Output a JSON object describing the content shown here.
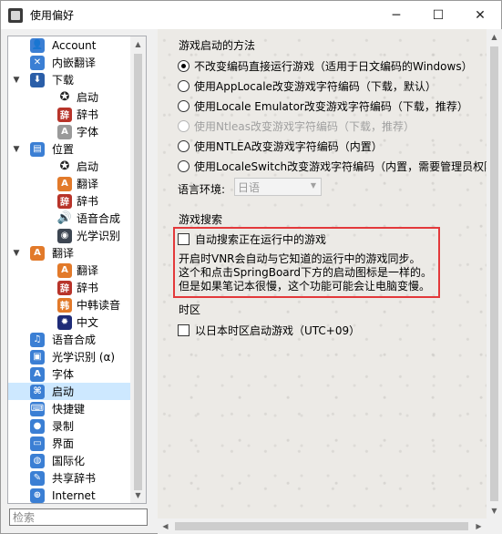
{
  "window": {
    "title": "使用偏好",
    "minimize": "─",
    "maximize": "☐",
    "close": "✕"
  },
  "tree": {
    "items": [
      {
        "label": "Account",
        "icon": "account-icon"
      },
      {
        "label": "内嵌翻译",
        "icon": "wrench-icon"
      },
      {
        "label": "下载",
        "icon": "download-icon",
        "expander": "▼"
      },
      {
        "label": "启动",
        "icon": "launch-icon"
      },
      {
        "label": "辞书",
        "icon": "dictionary-icon"
      },
      {
        "label": "字体",
        "icon": "font-icon"
      },
      {
        "label": "位置",
        "icon": "location-icon",
        "expander": "▼"
      },
      {
        "label": "启动",
        "icon": "launch-icon"
      },
      {
        "label": "翻译",
        "icon": "translate-icon"
      },
      {
        "label": "辞书",
        "icon": "dictionary-icon"
      },
      {
        "label": "语音合成",
        "icon": "speaker-icon"
      },
      {
        "label": "光学识别",
        "icon": "ocr-icon"
      },
      {
        "label": "翻译",
        "icon": "translate-icon",
        "expander": "▼"
      },
      {
        "label": "翻译",
        "icon": "translate-icon"
      },
      {
        "label": "辞书",
        "icon": "dictionary-icon"
      },
      {
        "label": "中韩读音",
        "icon": "korean-icon"
      },
      {
        "label": "中文",
        "icon": "chinese-icon"
      },
      {
        "label": "语音合成",
        "icon": "tts-icon"
      },
      {
        "label": "光学识别 (α)",
        "icon": "ocr-alpha-icon"
      },
      {
        "label": "字体",
        "icon": "font-icon"
      },
      {
        "label": "启动",
        "icon": "launch-icon"
      },
      {
        "label": "快捷键",
        "icon": "shortcut-icon"
      },
      {
        "label": "录制",
        "icon": "record-icon"
      },
      {
        "label": "界面",
        "icon": "ui-icon"
      },
      {
        "label": "国际化",
        "icon": "globe-icon"
      },
      {
        "label": "共享辞书",
        "icon": "shared-dictionary-icon"
      },
      {
        "label": "Internet",
        "icon": "internet-icon"
      }
    ]
  },
  "search": {
    "placeholder": "检索"
  },
  "launch_method": {
    "title": "游戏启动的方法",
    "options": [
      {
        "label": "不改变编码直接运行游戏（适用于日文编码的Windows）",
        "checked": true,
        "disabled": false
      },
      {
        "label": "使用AppLocale改变游戏字符编码（下载，默认）",
        "checked": false,
        "disabled": false
      },
      {
        "label": "使用Locale Emulator改变游戏字符编码（下载，推荐）",
        "checked": false,
        "disabled": false
      },
      {
        "label": "使用Ntleas改变游戏字符编码（下载，推荐）",
        "checked": false,
        "disabled": true
      },
      {
        "label": "使用NTLEA改变游戏字符编码（内置）",
        "checked": false,
        "disabled": false
      },
      {
        "label": "使用LocaleSwitch改变游戏字符编码（内置，需要管理员权限）",
        "checked": false,
        "disabled": false
      }
    ],
    "language_label": "语言环境:",
    "language_value": "日语"
  },
  "game_search": {
    "title": "游戏搜索",
    "checkbox_label": "自动搜索正在运行中的游戏",
    "desc1": "开启时VNR会自动与它知道的运行中的游戏同步。",
    "desc2": "这个和点击SpringBoard下方的启动图标是一样的。",
    "desc3": "但是如果笔记本很慢，这个功能可能会让电脑变慢。"
  },
  "timezone": {
    "title": "时区",
    "checkbox_label": "以日本时区启动游戏（UTC+09）"
  },
  "colors": {
    "highlight_border": "#e3393b",
    "selected_row": "#cde8ff"
  }
}
